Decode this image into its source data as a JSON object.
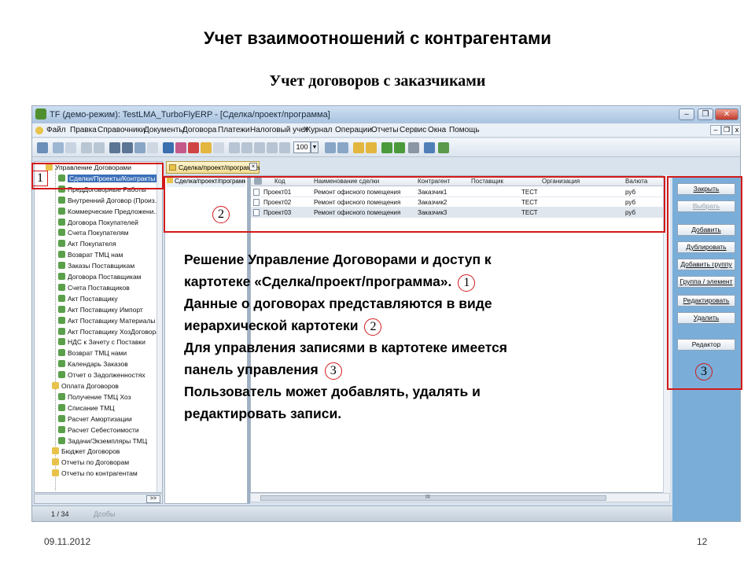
{
  "slide": {
    "title": "Учет взаимоотношений с контрагентами",
    "subtitle": "Учет договоров с заказчиками",
    "date": "09.11.2012",
    "page_number": "12"
  },
  "app": {
    "window_title": "TF (демо-режим): TestLMA_TurboFlyERP - [Сделка/проект/программа]",
    "menu": [
      "Файл",
      "Правка",
      "Справочники",
      "Документы",
      "Договора",
      "Платежи",
      "Налоговый учет",
      "Журнал",
      "Операции",
      "Отчеты",
      "Сервис",
      "Окна",
      "Помощь"
    ],
    "toolbar_zoom": "100",
    "tree": {
      "items": [
        {
          "label": "Управление Договорами",
          "type": "folder"
        },
        {
          "label": "Сделки/Проекты/Контракты",
          "type": "doc",
          "selected": true
        },
        {
          "label": "ПредДоговорные Работы",
          "type": "doc"
        },
        {
          "label": "Внутренний Договор (Произ...",
          "type": "doc"
        },
        {
          "label": "Коммерческие Предложени...",
          "type": "doc"
        },
        {
          "label": "Договора Покупателей",
          "type": "doc"
        },
        {
          "label": "Счета Покупателям",
          "type": "doc"
        },
        {
          "label": "Акт Покупателя",
          "type": "doc"
        },
        {
          "label": "Возврат ТМЦ нам",
          "type": "doc"
        },
        {
          "label": "Заказы Поставщикам",
          "type": "doc"
        },
        {
          "label": "Договора Поставщикам",
          "type": "doc"
        },
        {
          "label": "Счета Поставщиков",
          "type": "doc"
        },
        {
          "label": "Акт Поставщику",
          "type": "doc"
        },
        {
          "label": "Акт Поставщику Импорт",
          "type": "doc"
        },
        {
          "label": "Акт Поставщику Материалы",
          "type": "doc"
        },
        {
          "label": "Акт Поставщику ХозДоговора",
          "type": "doc"
        },
        {
          "label": "НДС к Зачету с Поставки",
          "type": "doc"
        },
        {
          "label": "Возврат ТМЦ нами",
          "type": "doc"
        },
        {
          "label": "Календарь Заказов",
          "type": "doc"
        },
        {
          "label": "Отчет о Задолженностях",
          "type": "doc"
        },
        {
          "label": "Оплата Договоров",
          "type": "folder"
        },
        {
          "label": "Получение ТМЦ Хоз",
          "type": "doc"
        },
        {
          "label": "Списание ТМЦ",
          "type": "doc"
        },
        {
          "label": "Расчет Амортизации",
          "type": "doc"
        },
        {
          "label": "Расчет Себестоимости",
          "type": "doc"
        },
        {
          "label": "Задачи/Экземпляры ТМЦ",
          "type": "doc"
        },
        {
          "label": "Бюджет Договоров",
          "type": "folder"
        },
        {
          "label": "Отчеты по Договорам",
          "type": "folder"
        },
        {
          "label": "Отчеты по контрагентам",
          "type": "folder"
        }
      ],
      "expand_button": ">>"
    },
    "tab_label": "Сделка/проект/программа",
    "left_panel_item": "Сделка/проект/программа",
    "grid": {
      "columns": [
        "Код",
        "Наименование сделки",
        "Контрагент",
        "Поставщик",
        "Организация",
        "Валюта"
      ],
      "rows": [
        [
          "Проект01",
          "Ремонт офисного помещения",
          "Заказчик1",
          "",
          "ТЕСТ",
          "руб"
        ],
        [
          "Проект02",
          "Ремонт офисного помещения",
          "Заказчик2",
          "",
          "ТЕСТ",
          "руб"
        ],
        [
          "Проект03",
          "Ремонт офисного помещения",
          "Заказчик3",
          "",
          "ТЕСТ",
          "руб"
        ]
      ],
      "hscroll_label": "III"
    },
    "buttons": {
      "close": "Закрыть",
      "select": "Выбрать",
      "add": "Добавить",
      "duplicate": "Дублировать",
      "add_group": "Добавить группу",
      "group_element": "Группа / элемент",
      "edit": "Редактировать",
      "delete": "Удалить",
      "editor": "Редактор"
    },
    "status": {
      "count": "1 / 34",
      "tag": "Дсобы"
    }
  },
  "annotations": {
    "badge1": "1",
    "badge2": "2",
    "badge3": "3",
    "note_lines": [
      "Решение Управление Договорами и доступ к",
      "картотеке «Сделка/проект/программа».",
      "Данные  о договорах представляются в виде",
      "иерархической картотеки",
      "Для управления записями в картотеке имеется",
      "панель управления",
      "Пользователь может добавлять, удалять и",
      "редактировать записи."
    ]
  }
}
